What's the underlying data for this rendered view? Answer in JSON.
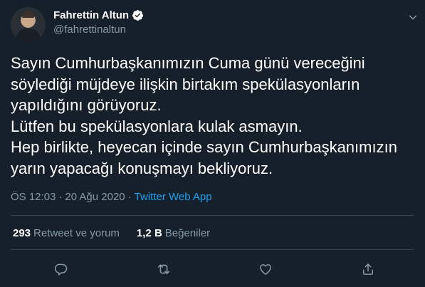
{
  "author": {
    "display_name": "Fahrettin Altun",
    "handle": "@fahrettinaltun",
    "verified": true
  },
  "tweet": {
    "lines": [
      "Sayın Cumhurbaşkanımızın Cuma günü vereceğini",
      "söylediği müjdeye ilişkin birtakım spekülasyonların",
      "yapıldığını görüyoruz.",
      "Lütfen bu spekülasyonlara kulak asmayın.",
      "Hep birlikte, heyecan içinde sayın  Cumhurbaşkanımızın",
      "yarın yapacağı konuşmayı bekliyoruz."
    ],
    "time": "ÖS 12:03",
    "separator": "·",
    "date": "20 Ağu 2020",
    "source": "Twitter Web App"
  },
  "stats": {
    "retweets_count": "293",
    "retweets_label": "Retweet ve yorum",
    "likes_count": "1,2 B",
    "likes_label": "Beğeniler"
  },
  "icons": {
    "more": "chevron-down-icon",
    "reply": "reply-icon",
    "retweet": "retweet-icon",
    "like": "heart-icon",
    "share": "share-icon"
  },
  "colors": {
    "background": "#15202b",
    "text": "#ffffff",
    "muted": "#8899a6",
    "link": "#1da1f2",
    "divider": "#38444d"
  }
}
